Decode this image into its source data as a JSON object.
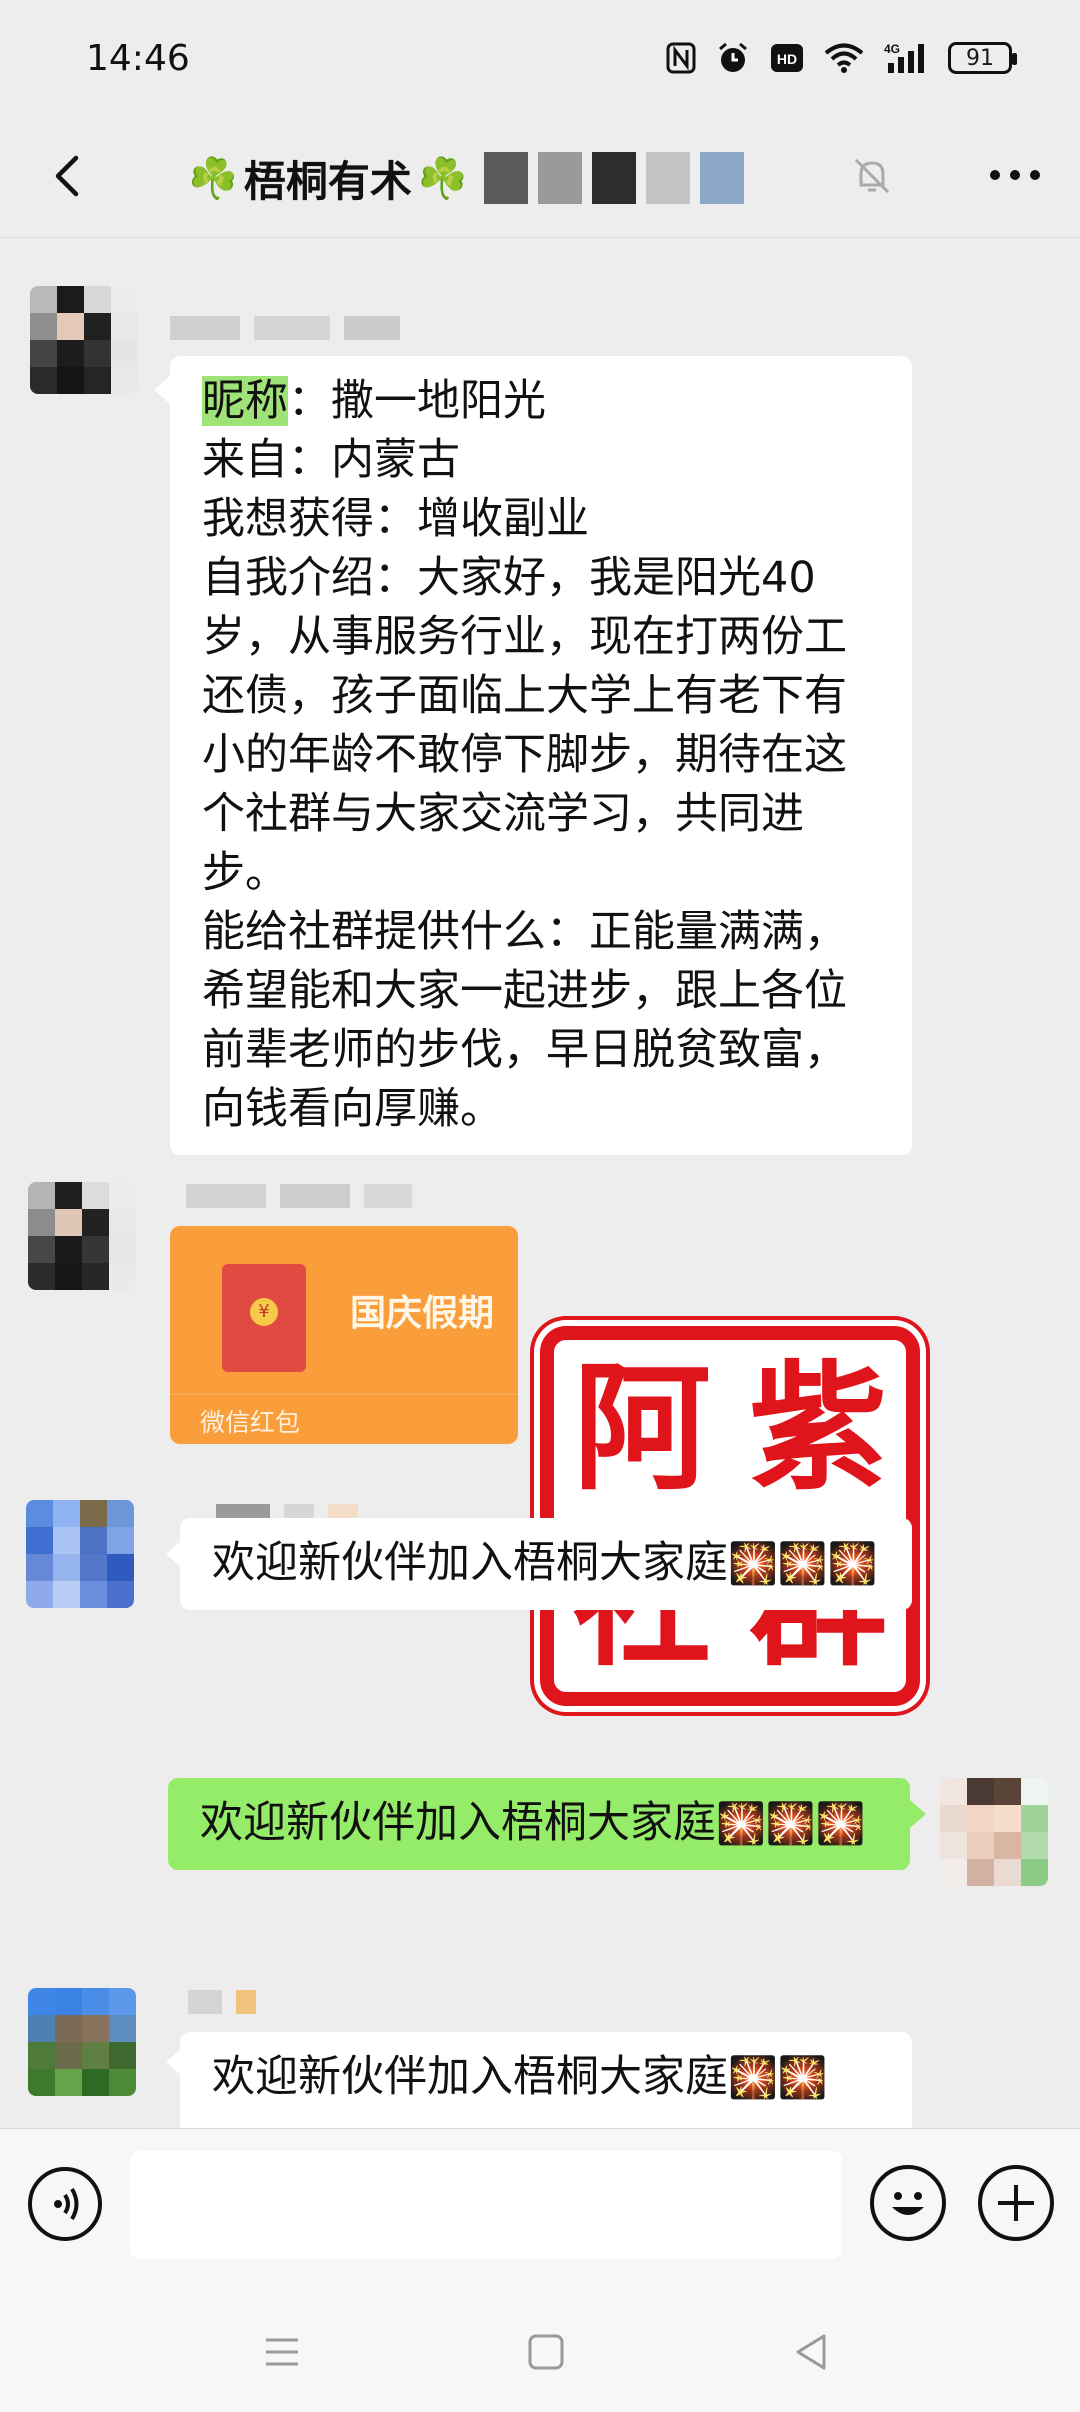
{
  "status_bar": {
    "time": "14:46",
    "network": "4G",
    "hd": "HD",
    "nfc": "N",
    "battery": "91"
  },
  "header": {
    "title": "梧桐有术",
    "title_emoji": "☘️",
    "back_icon": "chevron-left-icon",
    "mute_icon": "bell-muted-icon",
    "more_icon": "more-dots-icon"
  },
  "messages": {
    "intro": {
      "lines": [
        {
          "label": "昵称",
          "text": "：撒一地阳光"
        },
        {
          "text": "来自：内蒙古"
        },
        {
          "text": "我想获得：增收副业"
        },
        {
          "text": "自我介绍：大家好，我是阳光40"
        },
        {
          "text": "岁，从事服务行业，现在打两份工"
        },
        {
          "text": "还债，孩子面临上大学上有老下有"
        },
        {
          "text": "小的年龄不敢停下脚步，期待在这"
        },
        {
          "text": "个社群与大家交流学习，共同进"
        },
        {
          "text": "步。"
        },
        {
          "text": "能给社群提供什么：正能量满满，"
        },
        {
          "text": "希望能和大家一起进步，跟上各位"
        },
        {
          "text": "前辈老师的步伐，早日脱贫致富，"
        },
        {
          "text": "向钱看向厚赚。"
        }
      ]
    },
    "red_packet": {
      "title": "国庆假期",
      "label": "微信红包",
      "coin": "¥"
    },
    "welcome_1": {
      "text": "欢迎新伙伴加入梧桐大家庭",
      "emoji": "🎇🎇🎇"
    },
    "welcome_self": {
      "text": "欢迎新伙伴加入梧桐大家庭",
      "emoji": "🎇🎇🎇"
    },
    "welcome_2": {
      "text": "欢迎新伙伴加入梧桐大家庭",
      "emoji": "🎇🎇"
    }
  },
  "stamp": {
    "chars": [
      "阿",
      "紫",
      "社",
      "群"
    ],
    "color": "#e0141b"
  },
  "input_bar": {
    "placeholder": "",
    "voice_icon": "voice-icon",
    "emoji_icon": "smiley-icon",
    "plus_icon": "plus-icon"
  },
  "colors": {
    "self_bubble": "#95ec69",
    "other_bubble": "#ffffff",
    "background": "#ededed",
    "red_packet": "#fa9d3b"
  }
}
